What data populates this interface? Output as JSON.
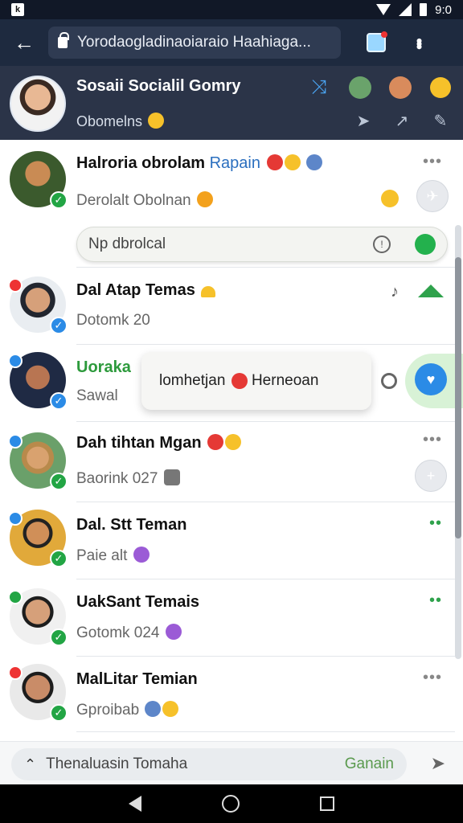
{
  "status_bar": {
    "time": "9:0"
  },
  "browser": {
    "back_label": "←",
    "url": "Yorodaogladinaoiaraio Haahiaga..."
  },
  "app_header": {
    "title": "Sosaii Socialil Gomry",
    "subtitle": "Obomelns",
    "icons": [
      "shuffle-icon",
      "avatar-icon",
      "avatar-icon",
      "smile-icon",
      "send-icon",
      "share-icon",
      "edit-icon"
    ]
  },
  "inline_search": {
    "placeholder": "Np dbrolcal"
  },
  "popup": {
    "text": "lomhetjan",
    "text2": "Herneoan"
  },
  "chats": [
    {
      "name": "Halroria obrolam",
      "name_accent": "Rapain",
      "message": "Derolalt Obolnan",
      "action": "more"
    },
    {
      "name": "Dal Atap Temas",
      "message": "Dotomk 20",
      "action": "chart"
    },
    {
      "name": "Uoraka",
      "message": "Sawal",
      "action": "check"
    },
    {
      "name": "Dah tihtan Mgan",
      "message": "Baorink 027",
      "action": "more"
    },
    {
      "name": "Dal. Stt Teman",
      "message": "Paie alt",
      "action": "dots"
    },
    {
      "name": "UakSant Temais",
      "message": "Gotomk 024",
      "action": "dots"
    },
    {
      "name": "MalLitar Temian",
      "message": "Gproibab",
      "action": "more"
    }
  ],
  "compose": {
    "placeholder": "Thenaluasin Tomaha",
    "action_label": "Ganain"
  },
  "colors": {
    "header_bg": "#2b3448",
    "browser_bg": "#1e2a3f",
    "accent_green": "#22a544",
    "accent_blue": "#2b8be6"
  }
}
